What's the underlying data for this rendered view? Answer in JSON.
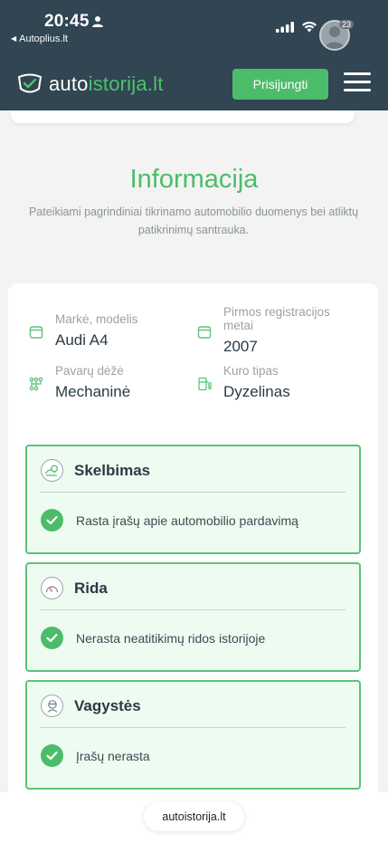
{
  "status": {
    "time": "20:45",
    "back_label": "Autoplius.lt",
    "avatar_badge": "23"
  },
  "navbar": {
    "logo_text_main": "auto",
    "logo_text_accent": "istorija.lt",
    "login_label": "Prisijungti"
  },
  "header": {
    "title": "Informacija",
    "subtitle": "Pateikiami pagrindiniai tikrinamo automobilio duomenys bei atliktų patikrinimų santrauka."
  },
  "vehicle": {
    "make_model": {
      "label": "Markė, modelis",
      "value": "Audi A4",
      "icon": "window-icon"
    },
    "first_registration": {
      "label_line1": "Pirmos registracijos",
      "label_line2": "metai",
      "value": "2007",
      "icon": "window-icon"
    },
    "gearbox": {
      "label": "Pavarų dėžė",
      "value": "Mechaninė",
      "icon": "gearbox-icon"
    },
    "fuel": {
      "label": "Kuro tipas",
      "value": "Dyzelinas",
      "icon": "fuel-pump-icon"
    }
  },
  "checks": [
    {
      "title": "Skelbimas",
      "result": "Rasta įrašų apie automobilio pardavimą",
      "icon": "car-sale-icon"
    },
    {
      "title": "Rida",
      "result": "Nerasta neatitikimų ridos istorijoje",
      "icon": "odometer-icon"
    },
    {
      "title": "Vagystės",
      "result": "Įrašų nerasta",
      "icon": "thief-icon"
    }
  ],
  "browser": {
    "url": "autoistorija.lt"
  },
  "colors": {
    "brand_dark": "#314552",
    "accent_green": "#4dbc6a",
    "check_bg": "#eefbf1"
  }
}
